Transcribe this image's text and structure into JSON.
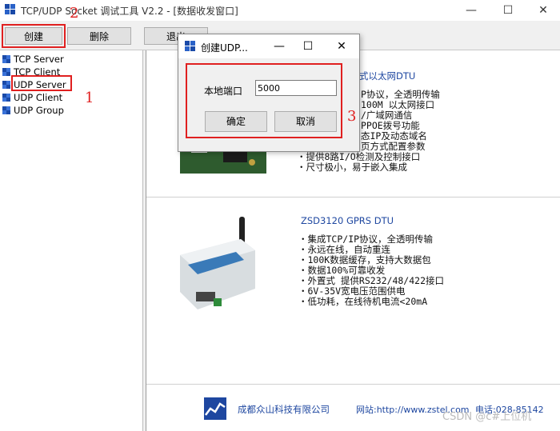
{
  "window": {
    "title": "TCP/UDP Socket 调试工具 V2.2 - [数据收发窗口]"
  },
  "toolbar": {
    "create": "创建",
    "delete": "删除",
    "exit": "退出"
  },
  "tree": {
    "items": [
      "TCP Server",
      "TCP Client",
      "UDP Server",
      "UDP Client",
      "UDP Group"
    ]
  },
  "content": {
    "product1": {
      "title": "式以太网DTU",
      "features": [
        "P协议，全透明传输",
        "100M 以太网接口",
        "/广域网通信",
        "PPOE拨号功能",
        "态IP及动态域名",
        "页方式配置参数",
        "・提供8路I/O检测及控制接口",
        "・尺寸极小，易于嵌入集成"
      ]
    },
    "product2": {
      "title": "ZSD3120 GPRS DTU",
      "features": [
        "・集成TCP/IP协议，全透明传输",
        "・永远在线，自动重连",
        "・100K数据缓存，支持大数据包",
        "・数据100%可靠收发",
        "・外置式 提供RS232/48/422接口",
        "・6V-35V宽电压范围供电",
        "・低功耗，在线待机电流<20mA"
      ]
    },
    "footer": {
      "company": "成都众山科技有限公司",
      "website": "网站:http://www.zstel.com",
      "phone": "电话:028-85142"
    }
  },
  "dialog": {
    "title": "创建UDP...",
    "port_label": "本地端口",
    "port_value": "5000",
    "ok": "确定",
    "cancel": "取消"
  },
  "annotations": {
    "n1": "1",
    "n2": "2",
    "n3": "3"
  },
  "watermark": "CSDN @c#上位机",
  "colors": {
    "annotation_red": "#e02020",
    "icon_blue": "#1e47a0"
  }
}
